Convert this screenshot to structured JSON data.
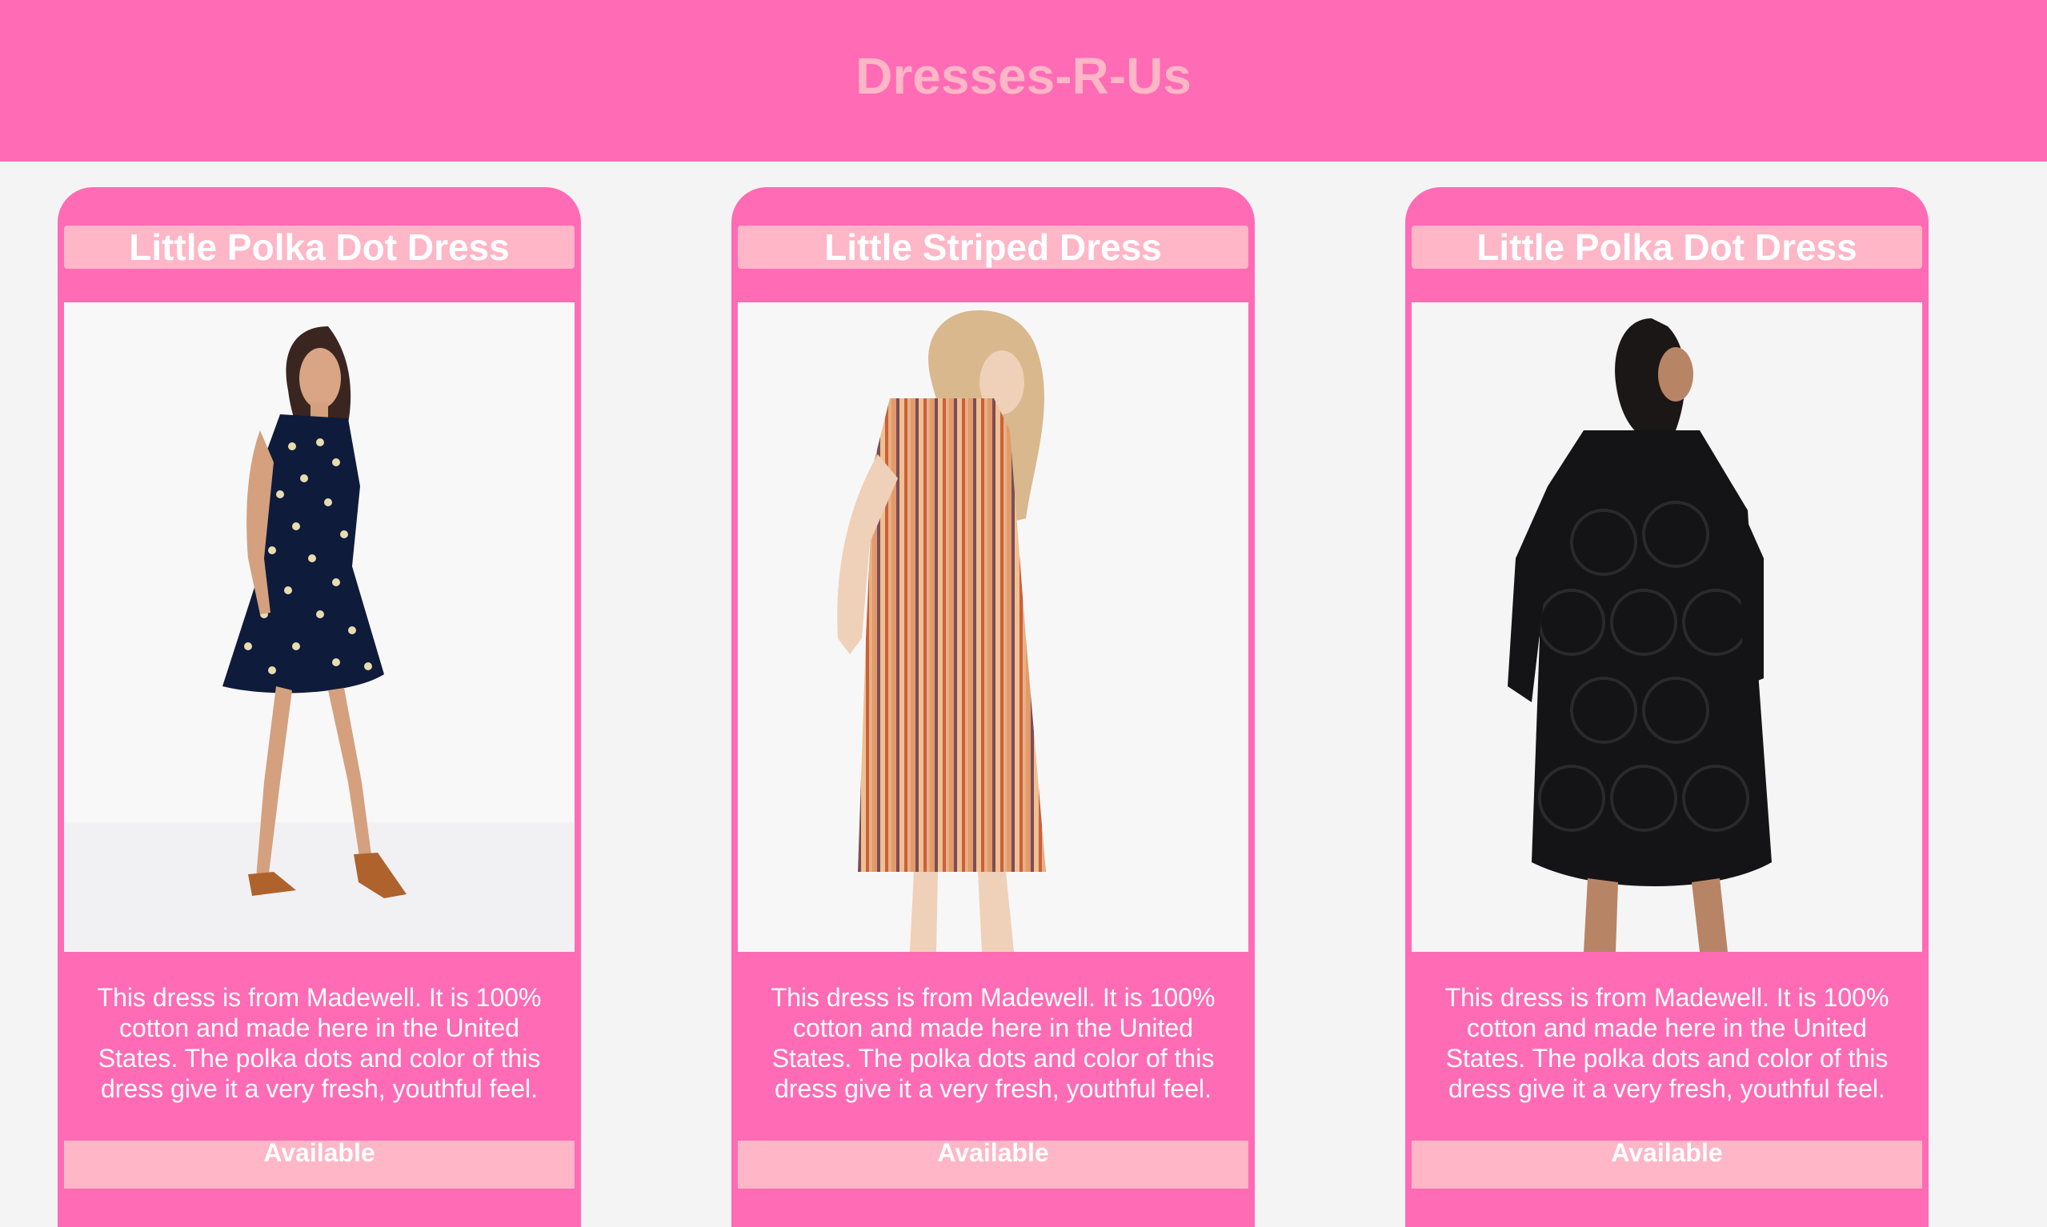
{
  "header": {
    "title": "Dresses-R-Us"
  },
  "colors": {
    "brand_pink": "#ff6bb5",
    "light_pink": "#ffb6c6",
    "background": "#f5f4f5"
  },
  "products": [
    {
      "title": "Little Polka Dot Dress",
      "image_icon": "woman-in-navy-polka-dot-dress-photo",
      "description": "This dress is from Madewell. It is 100% cotton and made here in the United States. The polka dots and color of this dress give it a very fresh, youthful feel.",
      "status": "Available"
    },
    {
      "title": "Little Striped Dress",
      "image_icon": "woman-in-striped-dress-photo",
      "description": "This dress is from Madewell. It is 100% cotton and made here in the United States. The polka dots and color of this dress give it a very fresh, youthful feel.",
      "status": "Available"
    },
    {
      "title": "Little Polka Dot Dress",
      "image_icon": "woman-in-black-dress-photo",
      "description": "This dress is from Madewell. It is 100% cotton and made here in the United States. The polka dots and color of this dress give it a very fresh, youthful feel.",
      "status": "Available"
    }
  ]
}
